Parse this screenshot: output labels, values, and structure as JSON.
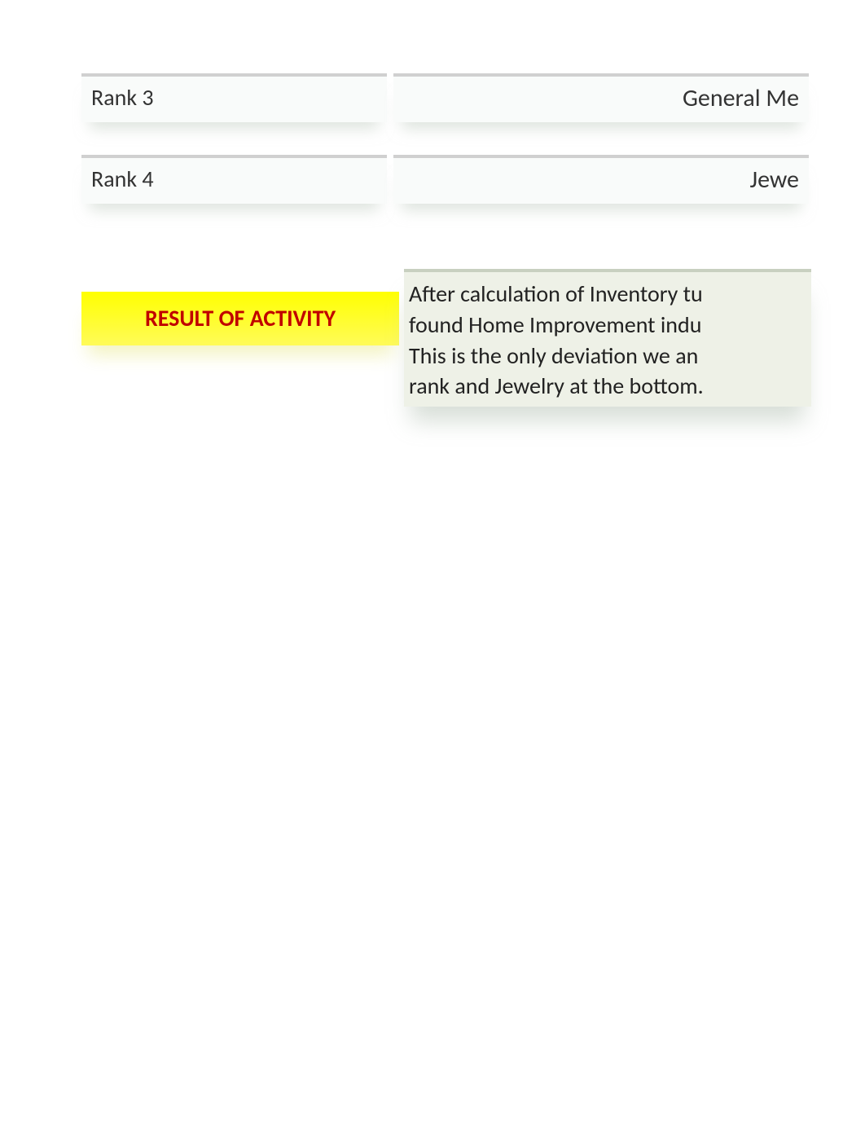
{
  "ranks": {
    "row3": {
      "label": "Rank 3",
      "value": "General Me"
    },
    "row4": {
      "label": "Rank 4",
      "value": "Jewe"
    }
  },
  "result": {
    "heading": "RESULT OF ACTIVITY",
    "line1": "After calculation of Inventory tu",
    "line2": "found Home Improvement indu",
    "line3": "This is the only deviation we an",
    "line4": "rank and Jewelry at the bottom."
  }
}
